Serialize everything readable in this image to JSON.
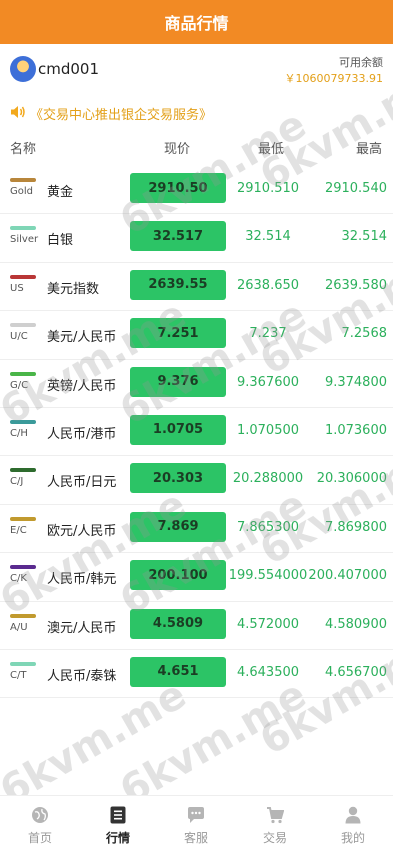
{
  "header": {
    "title": "商品行情"
  },
  "user": {
    "name": "cmd001",
    "balance_label": "可用余额",
    "balance_value": "￥1060079733.91"
  },
  "notice": {
    "text": "《交易中心推出银企交易服务》"
  },
  "columns": {
    "name": "名称",
    "price": "现价",
    "low": "最低",
    "high": "最高"
  },
  "rows": [
    {
      "code": "Gold",
      "name": "黄金",
      "price": "2910.50",
      "low": "2910.510",
      "high": "2910.540",
      "color": "#b8863b"
    },
    {
      "code": "Silver",
      "name": "白银",
      "price": "32.517",
      "low": "32.514",
      "high": "32.514",
      "color": "#7fd6b6"
    },
    {
      "code": "US",
      "name": "美元指数",
      "price": "2639.55",
      "low": "2638.650",
      "high": "2639.580",
      "color": "#b93636"
    },
    {
      "code": "U/C",
      "name": "美元/人民币",
      "price": "7.251",
      "low": "7.237",
      "high": "7.2568",
      "color": "#cfcfcf"
    },
    {
      "code": "G/C",
      "name": "英镑/人民币",
      "price": "9.376",
      "low": "9.367600",
      "high": "9.374800",
      "color": "#49b548"
    },
    {
      "code": "C/H",
      "name": "人民币/港币",
      "price": "1.0705",
      "low": "1.070500",
      "high": "1.073600",
      "color": "#3a9a9a"
    },
    {
      "code": "C/J",
      "name": "人民币/日元",
      "price": "20.303",
      "low": "20.288000",
      "high": "20.306000",
      "color": "#2e6b2e"
    },
    {
      "code": "E/C",
      "name": "欧元/人民币",
      "price": "7.869",
      "low": "7.865300",
      "high": "7.869800",
      "color": "#c19a2e"
    },
    {
      "code": "C/K",
      "name": "人民币/韩元",
      "price": "200.100",
      "low": "199.554000",
      "high": "200.407000",
      "color": "#5a2a8f"
    },
    {
      "code": "A/U",
      "name": "澳元/人民币",
      "price": "4.5809",
      "low": "4.572000",
      "high": "4.580900",
      "color": "#c19a2e"
    },
    {
      "code": "C/T",
      "name": "人民币/泰铢",
      "price": "4.651",
      "low": "4.643500",
      "high": "4.656700",
      "color": "#7fd6b6"
    }
  ],
  "watermark": "6kvm.me",
  "tabs": [
    {
      "label": "首页",
      "icon": "globe-icon"
    },
    {
      "label": "行情",
      "icon": "list-icon"
    },
    {
      "label": "客服",
      "icon": "chat-icon"
    },
    {
      "label": "交易",
      "icon": "cart-icon"
    },
    {
      "label": "我的",
      "icon": "user-icon"
    }
  ],
  "active_tab": "行情"
}
